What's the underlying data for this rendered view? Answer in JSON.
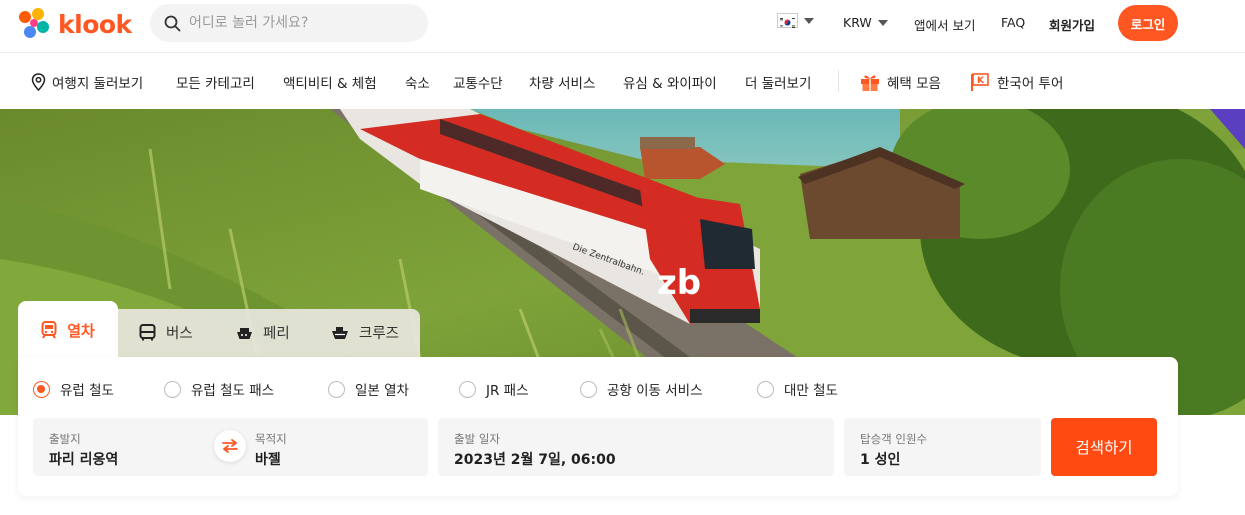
{
  "brand": {
    "name": "klook",
    "accent": "#ff5722"
  },
  "header": {
    "search_placeholder": "어디로 놀러 가세요?",
    "currency": "KRW",
    "links": [
      "앱에서 보기",
      "FAQ",
      "회원가입"
    ],
    "login": "로그인"
  },
  "nav": {
    "items": [
      "여행지 둘러보기",
      "모든 카테고리",
      "액티비티 & 체험",
      "숙소",
      "교통수단",
      "차량 서비스",
      "유심 & 와이파이",
      "더 둘러보기"
    ],
    "promo": [
      "혜택 모음",
      "한국어 투어"
    ]
  },
  "hero": {
    "train_brand": "zb",
    "train_text": "Die Zentralbahn."
  },
  "booking": {
    "tabs": [
      "열차",
      "버스",
      "페리",
      "크루즈"
    ],
    "active_tab": "열차",
    "train_types": [
      "유럽 철도",
      "유럽 철도 패스",
      "일본 열차",
      "JR 패스",
      "공항 이동 서비스",
      "대만 철도"
    ],
    "selected_type": "유럽 철도",
    "fields": {
      "origin_label": "출발지",
      "origin_value": "파리 리옹역",
      "dest_label": "목적지",
      "dest_value": "바젤",
      "date_label": "출발 일자",
      "date_value": "2023년 2월 7일, 06:00",
      "pax_label": "탑승객 인원수",
      "pax_value": "1 성인"
    },
    "search_button": "검색하기"
  }
}
